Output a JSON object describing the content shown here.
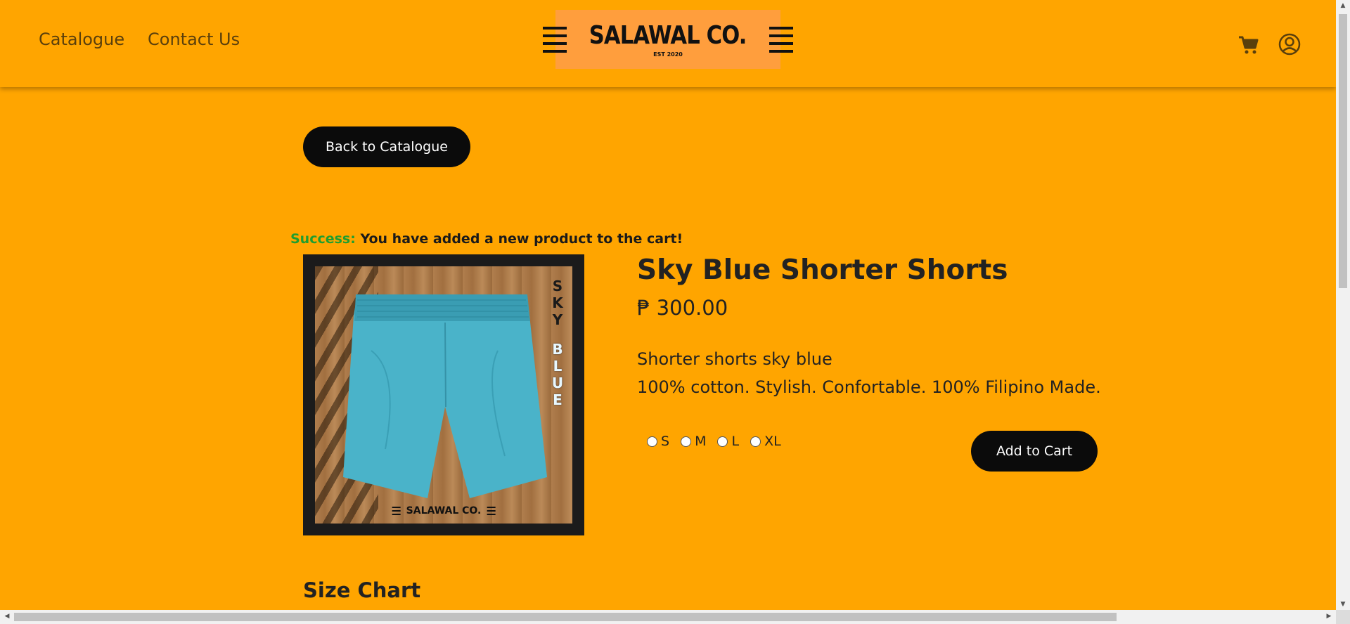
{
  "header": {
    "nav": [
      {
        "label": "Catalogue"
      },
      {
        "label": "Contact Us"
      }
    ],
    "logo": {
      "name": "SALAWAL CO.",
      "est": "EST 2020"
    },
    "icons": {
      "cart": "cart-icon",
      "account": "user-circle-icon"
    }
  },
  "main": {
    "back_label": "Back to Catalogue",
    "alert": {
      "label": "Success:",
      "message": "You have added a new product to the cart!",
      "label_color": "#1f9e2f"
    },
    "product": {
      "title": "Sky Blue Shorter Shorts",
      "price": "₱ 300.00",
      "description_line1": "Shorter shorts sky blue",
      "description_line2": "100% cotton. Stylish. Confortable. 100% Filipino Made.",
      "image_side_text_top": [
        "S",
        "K",
        "Y"
      ],
      "image_side_text_bottom": [
        "B",
        "L",
        "U",
        "E"
      ],
      "image_logo": "SALAWAL CO."
    },
    "sizes": [
      {
        "label": "S"
      },
      {
        "label": "M"
      },
      {
        "label": "L"
      },
      {
        "label": "XL"
      }
    ],
    "add_to_cart_label": "Add to Cart",
    "size_chart_heading": "Size Chart"
  },
  "colors": {
    "background": "#FFA500",
    "button": "#0b0b0b",
    "shorts": "#4ab3c9"
  }
}
